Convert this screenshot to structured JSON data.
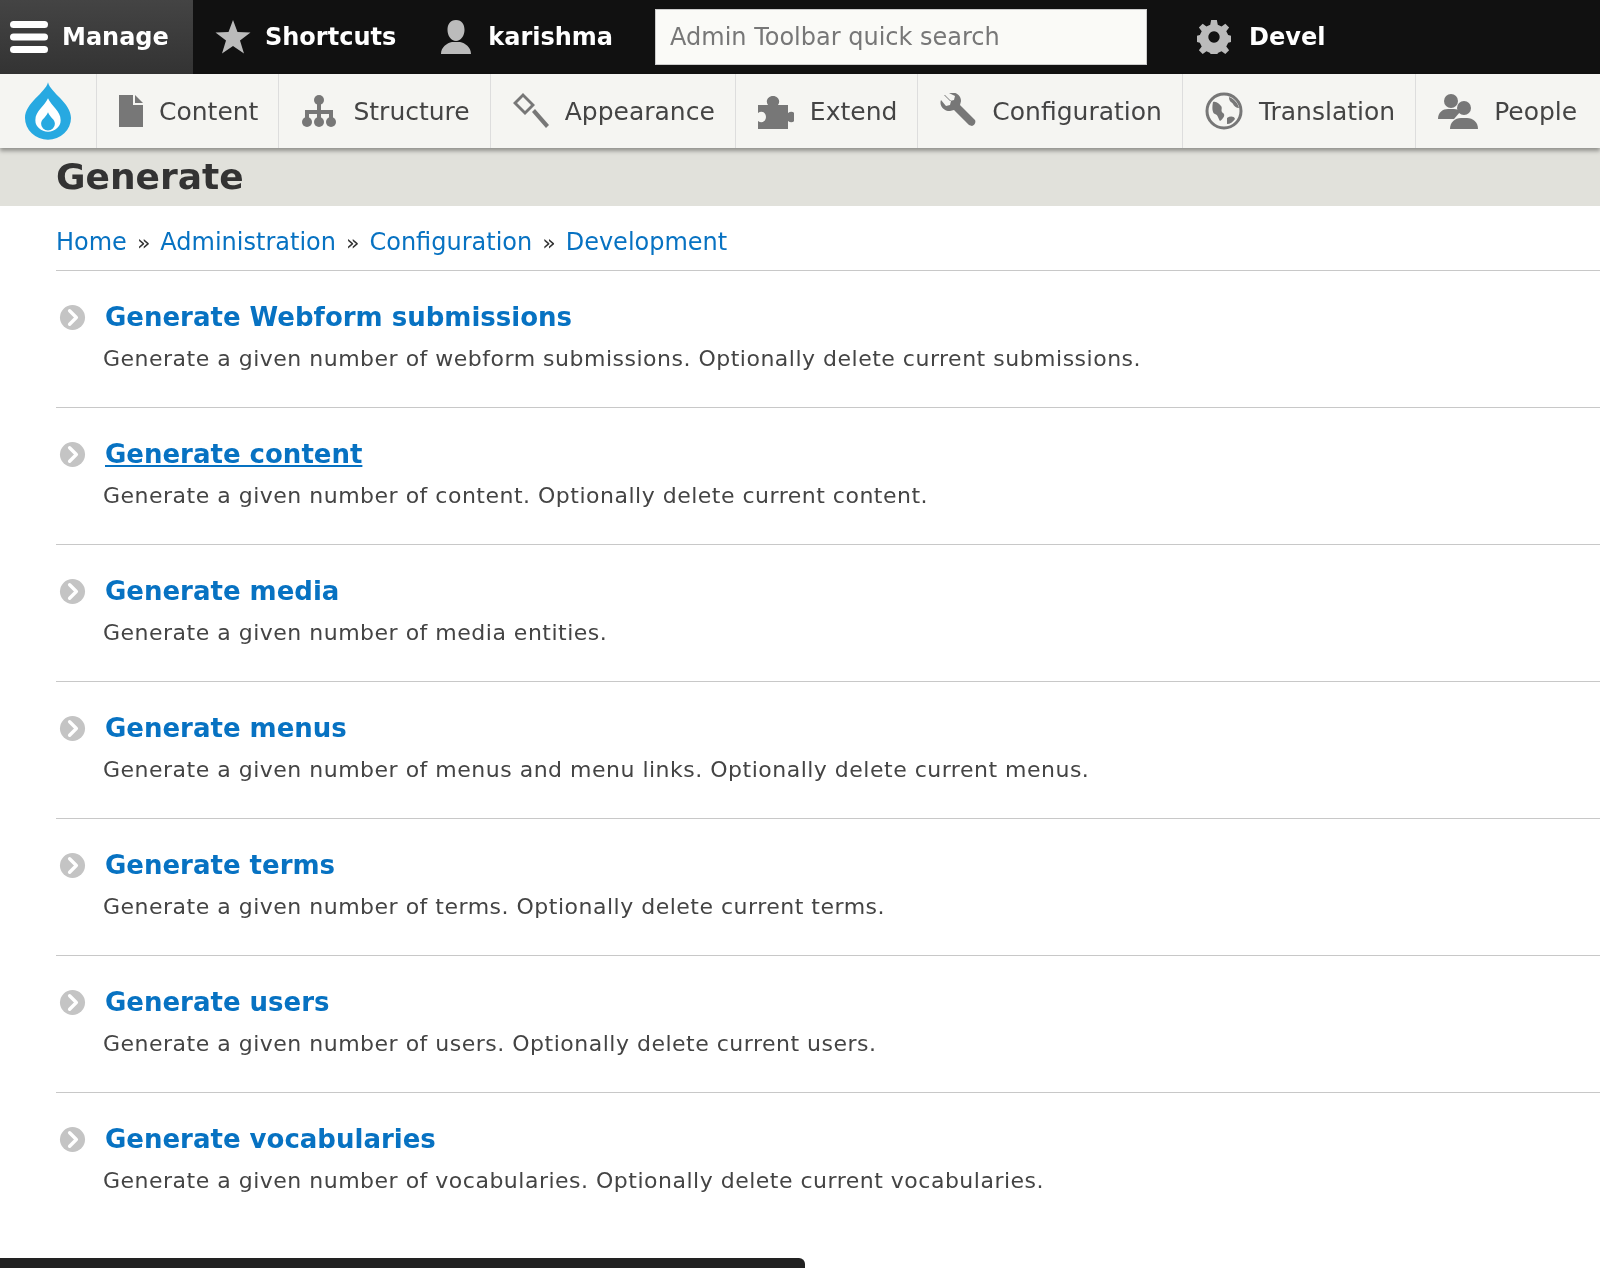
{
  "toolbar": {
    "items": [
      {
        "label": "Manage",
        "kind": "menu",
        "selected": true
      },
      {
        "label": "Shortcuts",
        "kind": "star",
        "selected": false
      },
      {
        "label": "karishma",
        "kind": "user",
        "selected": false
      }
    ],
    "search": {
      "placeholder": "Admin Toolbar quick search"
    },
    "devel": {
      "label": "Devel"
    }
  },
  "tray": {
    "items": [
      {
        "label": "Content",
        "kind": "content"
      },
      {
        "label": "Structure",
        "kind": "structure"
      },
      {
        "label": "Appearance",
        "kind": "appearance"
      },
      {
        "label": "Extend",
        "kind": "extend"
      },
      {
        "label": "Configuration",
        "kind": "configuration"
      },
      {
        "label": "Translation",
        "kind": "translation"
      },
      {
        "label": "People",
        "kind": "people"
      }
    ]
  },
  "page_title": "Generate",
  "breadcrumb": [
    "Home",
    "Administration",
    "Configuration",
    "Development"
  ],
  "breadcrumb_separator": "»",
  "entries": [
    {
      "title": "Generate Webform submissions",
      "description": "Generate a given number of webform submissions. Optionally delete current submissions.",
      "focused": false
    },
    {
      "title": "Generate content",
      "description": "Generate a given number of content. Optionally delete current content.",
      "focused": true
    },
    {
      "title": "Generate media",
      "description": "Generate a given number of media entities.",
      "focused": false
    },
    {
      "title": "Generate menus",
      "description": "Generate a given number of menus and menu links. Optionally delete current menus.",
      "focused": false
    },
    {
      "title": "Generate terms",
      "description": "Generate a given number of terms. Optionally delete current terms.",
      "focused": false
    },
    {
      "title": "Generate users",
      "description": "Generate a given number of users. Optionally delete current users.",
      "focused": false
    },
    {
      "title": "Generate vocabularies",
      "description": "Generate a given number of vocabularies. Optionally delete current vocabularies.",
      "focused": false
    }
  ]
}
